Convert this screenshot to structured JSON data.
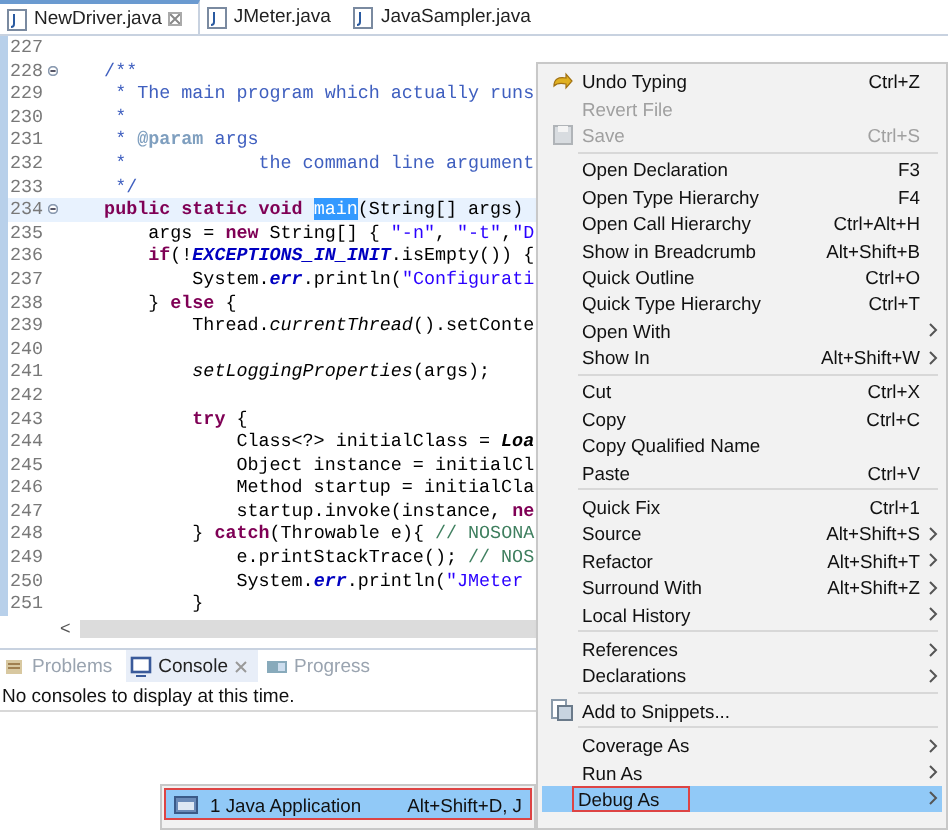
{
  "editor_tabs": [
    {
      "label": "NewDriver.java",
      "selected": true
    },
    {
      "label": "JMeter.java",
      "selected": false
    },
    {
      "label": "JavaSampler.java",
      "selected": false
    }
  ],
  "editor": {
    "lines": [
      {
        "number": "227",
        "current": false,
        "fold": false
      },
      {
        "number": "228",
        "current": false,
        "fold": true,
        "code": [
          {
            "kind": "comment",
            "text": "    /**"
          }
        ]
      },
      {
        "number": "229",
        "current": false,
        "fold": false,
        "code": [
          {
            "kind": "comment",
            "text": "     * The main program which actually runs"
          }
        ]
      },
      {
        "number": "230",
        "current": false,
        "fold": false,
        "code": [
          {
            "kind": "comment",
            "text": "     *"
          }
        ]
      },
      {
        "number": "231",
        "current": false,
        "fold": false,
        "code": [
          {
            "kind": "comment",
            "text": "     * "
          },
          {
            "kind": "tag",
            "text": "@param"
          },
          {
            "kind": "comment",
            "text": " args"
          }
        ]
      },
      {
        "number": "232",
        "current": false,
        "fold": false,
        "code": [
          {
            "kind": "comment",
            "text": "     *            the command line argument"
          }
        ]
      },
      {
        "number": "233",
        "current": false,
        "fold": false,
        "code": [
          {
            "kind": "comment",
            "text": "     */"
          }
        ]
      },
      {
        "number": "234",
        "current": true,
        "fold": true,
        "code": [
          {
            "kind": "kw",
            "text": "    public static void "
          },
          {
            "kind": "selected",
            "text": "main"
          },
          {
            "kind": "plain",
            "text": "(String[] args)"
          }
        ]
      },
      {
        "number": "235",
        "current": false,
        "fold": false,
        "code": [
          {
            "kind": "plain",
            "text": "        args = "
          },
          {
            "kind": "kw",
            "text": "new"
          },
          {
            "kind": "plain",
            "text": " String[] { "
          },
          {
            "kind": "string",
            "text": "\"-n\""
          },
          {
            "kind": "plain",
            "text": ", "
          },
          {
            "kind": "string",
            "text": "\"-t\""
          },
          {
            "kind": "plain",
            "text": ","
          },
          {
            "kind": "string",
            "text": "\"D"
          }
        ]
      },
      {
        "number": "236",
        "current": false,
        "fold": false,
        "code": [
          {
            "kind": "kw",
            "text": "        if"
          },
          {
            "kind": "plain",
            "text": "(!"
          },
          {
            "kind": "field",
            "text": "EXCEPTIONS_IN_INIT"
          },
          {
            "kind": "plain",
            "text": ".isEmpty()) {"
          }
        ]
      },
      {
        "number": "237",
        "current": false,
        "fold": false,
        "code": [
          {
            "kind": "plain",
            "text": "            System."
          },
          {
            "kind": "field",
            "text": "err"
          },
          {
            "kind": "plain",
            "text": ".println("
          },
          {
            "kind": "string",
            "text": "\"Configurati"
          }
        ]
      },
      {
        "number": "238",
        "current": false,
        "fold": false,
        "code": [
          {
            "kind": "plain",
            "text": "        } "
          },
          {
            "kind": "kw",
            "text": "else"
          },
          {
            "kind": "plain",
            "text": " {"
          }
        ]
      },
      {
        "number": "239",
        "current": false,
        "fold": false,
        "code": [
          {
            "kind": "plain",
            "text": "            Thread."
          },
          {
            "kind": "method",
            "text": "currentThread"
          },
          {
            "kind": "plain",
            "text": "().setConte"
          }
        ]
      },
      {
        "number": "240",
        "current": false,
        "fold": false
      },
      {
        "number": "241",
        "current": false,
        "fold": false,
        "code": [
          {
            "kind": "method",
            "text": "            setLoggingProperties"
          },
          {
            "kind": "plain",
            "text": "(args);"
          }
        ]
      },
      {
        "number": "242",
        "current": false,
        "fold": false
      },
      {
        "number": "243",
        "current": false,
        "fold": false,
        "code": [
          {
            "kind": "kw",
            "text": "            try"
          },
          {
            "kind": "plain",
            "text": " {"
          }
        ]
      },
      {
        "number": "244",
        "current": false,
        "fold": false,
        "code": [
          {
            "kind": "plain",
            "text": "                Class<?> initialClass = "
          },
          {
            "kind": "smethod",
            "text": "Loa"
          }
        ]
      },
      {
        "number": "245",
        "current": false,
        "fold": false,
        "code": [
          {
            "kind": "plain",
            "text": "                Object instance = initialCl"
          }
        ]
      },
      {
        "number": "246",
        "current": false,
        "fold": false,
        "code": [
          {
            "kind": "plain",
            "text": "                Method startup = initialCla"
          }
        ]
      },
      {
        "number": "247",
        "current": false,
        "fold": false,
        "code": [
          {
            "kind": "plain",
            "text": "                startup.invoke(instance, "
          },
          {
            "kind": "kw",
            "text": "ne"
          }
        ]
      },
      {
        "number": "248",
        "current": false,
        "fold": false,
        "code": [
          {
            "kind": "plain",
            "text": "            } "
          },
          {
            "kind": "kw",
            "text": "catch"
          },
          {
            "kind": "plain",
            "text": "(Throwable e){ "
          },
          {
            "kind": "linecomment",
            "text": "// NOSONA"
          }
        ]
      },
      {
        "number": "249",
        "current": false,
        "fold": false,
        "code": [
          {
            "kind": "plain",
            "text": "                e.printStackTrace(); "
          },
          {
            "kind": "linecomment",
            "text": "// NOS"
          }
        ]
      },
      {
        "number": "250",
        "current": false,
        "fold": false,
        "code": [
          {
            "kind": "plain",
            "text": "                System."
          },
          {
            "kind": "field",
            "text": "err"
          },
          {
            "kind": "plain",
            "text": ".println("
          },
          {
            "kind": "string",
            "text": "\"JMeter "
          }
        ]
      },
      {
        "number": "251",
        "current": false,
        "fold": false,
        "code": [
          {
            "kind": "plain",
            "text": "            }"
          }
        ]
      }
    ],
    "scroll_arrow": "<"
  },
  "panel": {
    "tabs": [
      {
        "label": "Problems",
        "selected": false
      },
      {
        "label": "Console",
        "selected": true
      },
      {
        "label": "Progress",
        "selected": false
      }
    ],
    "message": "No consoles to display at this time."
  },
  "context_menu": {
    "groups": [
      [
        {
          "label": "Undo Typing",
          "shortcut": "Ctrl+Z",
          "disabled": false,
          "submenu": false,
          "selected": false
        },
        {
          "label": "Revert File",
          "disabled": true,
          "submenu": false,
          "selected": false
        },
        {
          "label": "Save",
          "shortcut": "Ctrl+S",
          "disabled": true,
          "submenu": false,
          "selected": false
        }
      ],
      [
        {
          "label": "Open Declaration",
          "shortcut": "F3",
          "disabled": false,
          "submenu": false,
          "selected": false
        },
        {
          "label": "Open Type Hierarchy",
          "shortcut": "F4",
          "disabled": false,
          "submenu": false,
          "selected": false
        },
        {
          "label": "Open Call Hierarchy",
          "shortcut": "Ctrl+Alt+H",
          "disabled": false,
          "submenu": false,
          "selected": false
        },
        {
          "label": "Show in Breadcrumb",
          "shortcut": "Alt+Shift+B",
          "disabled": false,
          "submenu": false,
          "selected": false
        },
        {
          "label": "Quick Outline",
          "shortcut": "Ctrl+O",
          "disabled": false,
          "submenu": false,
          "selected": false
        },
        {
          "label": "Quick Type Hierarchy",
          "shortcut": "Ctrl+T",
          "disabled": false,
          "submenu": false,
          "selected": false
        },
        {
          "label": "Open With",
          "disabled": false,
          "submenu": true,
          "selected": false
        },
        {
          "label": "Show In",
          "shortcut": "Alt+Shift+W",
          "disabled": false,
          "submenu": true,
          "selected": false
        }
      ],
      [
        {
          "label": "Cut",
          "shortcut": "Ctrl+X",
          "disabled": false,
          "submenu": false,
          "selected": false
        },
        {
          "label": "Copy",
          "shortcut": "Ctrl+C",
          "disabled": false,
          "submenu": false,
          "selected": false
        },
        {
          "label": "Copy Qualified Name",
          "disabled": false,
          "submenu": false,
          "selected": false
        },
        {
          "label": "Paste",
          "shortcut": "Ctrl+V",
          "disabled": false,
          "submenu": false,
          "selected": false
        }
      ],
      [
        {
          "label": "Quick Fix",
          "shortcut": "Ctrl+1",
          "disabled": false,
          "submenu": false,
          "selected": false
        },
        {
          "label": "Source",
          "shortcut": "Alt+Shift+S",
          "disabled": false,
          "submenu": true,
          "selected": false
        },
        {
          "label": "Refactor",
          "shortcut": "Alt+Shift+T",
          "disabled": false,
          "submenu": true,
          "selected": false
        },
        {
          "label": "Surround With",
          "shortcut": "Alt+Shift+Z",
          "disabled": false,
          "submenu": true,
          "selected": false
        },
        {
          "label": "Local History",
          "disabled": false,
          "submenu": true,
          "selected": false
        }
      ],
      [
        {
          "label": "References",
          "disabled": false,
          "submenu": true,
          "selected": false
        },
        {
          "label": "Declarations",
          "disabled": false,
          "submenu": true,
          "selected": false
        }
      ],
      [
        {
          "label": "Add to Snippets...",
          "disabled": false,
          "submenu": false,
          "selected": false
        }
      ],
      [
        {
          "label": "Coverage As",
          "disabled": false,
          "submenu": true,
          "selected": false
        },
        {
          "label": "Run As",
          "disabled": false,
          "submenu": true,
          "selected": false
        },
        {
          "label": "Debug As",
          "disabled": false,
          "submenu": true,
          "selected": true,
          "outlined": true
        }
      ]
    ]
  },
  "submenu": {
    "items": [
      {
        "label": "1 Java Application",
        "shortcut": "Alt+Shift+D, J",
        "selected": true,
        "outlined": true
      }
    ]
  }
}
